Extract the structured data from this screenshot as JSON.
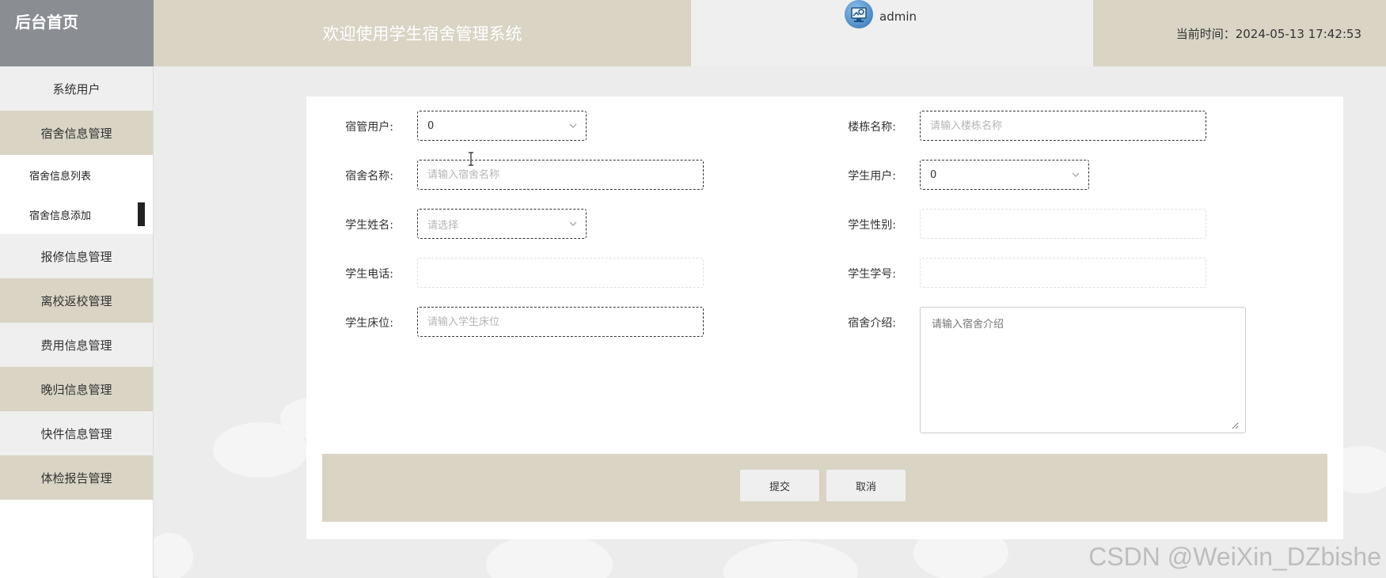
{
  "header": {
    "home_label": "后台首页",
    "welcome": "欢迎使用学生宿舍管理系统",
    "username": "admin",
    "time_label": "当前时间：2024-05-13 17:42:53"
  },
  "sidebar": {
    "items": [
      {
        "label": "系统用户"
      },
      {
        "label": "宿舍信息管理"
      },
      {
        "label": "报修信息管理"
      },
      {
        "label": "离校返校管理"
      },
      {
        "label": "费用信息管理"
      },
      {
        "label": "晚归信息管理"
      },
      {
        "label": "快件信息管理"
      },
      {
        "label": "体检报告管理"
      }
    ],
    "sub_items": [
      {
        "label": "宿舍信息列表"
      },
      {
        "label": "宿舍信息添加"
      }
    ]
  },
  "form": {
    "dorm_manager": {
      "label": "宿管用户:",
      "value": "0"
    },
    "building": {
      "label": "楼栋名称:",
      "placeholder": "请输入楼栋名称"
    },
    "dorm_name": {
      "label": "宿舍名称:",
      "placeholder": "请输入宿舍名称"
    },
    "student_user": {
      "label": "学生用户:",
      "value": "0"
    },
    "student_name": {
      "label": "学生姓名:",
      "placeholder": "请选择"
    },
    "student_gender": {
      "label": "学生性别:",
      "value": ""
    },
    "student_phone": {
      "label": "学生电话:",
      "value": ""
    },
    "student_no": {
      "label": "学生学号:",
      "value": ""
    },
    "student_bed": {
      "label": "学生床位:",
      "placeholder": "请输入学生床位"
    },
    "dorm_intro": {
      "label": "宿舍介绍:",
      "placeholder": "请输入宿舍介绍"
    },
    "submit_label": "提交",
    "cancel_label": "取消"
  },
  "watermark": "CSDN @WeiXin_DZbishe",
  "colors": {
    "header_dark": "#8a8d92",
    "tan": "#d9d4c4",
    "light_gray": "#efefef"
  }
}
